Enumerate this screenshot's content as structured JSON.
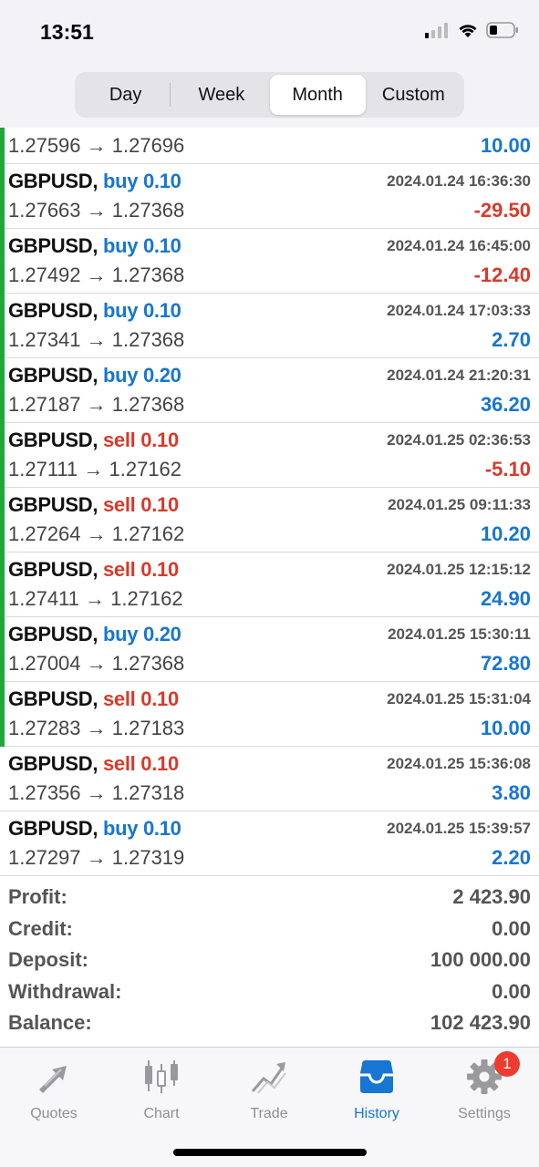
{
  "status": {
    "time": "13:51"
  },
  "period_tabs": [
    {
      "label": "Day",
      "active": false
    },
    {
      "label": "Week",
      "active": false
    },
    {
      "label": "Month",
      "active": true
    },
    {
      "label": "Custom",
      "active": false
    }
  ],
  "first_row": {
    "prices": "1.27596 → 1.27696",
    "profit": "10.00"
  },
  "trades": [
    {
      "symbol": "GBPUSD,",
      "side": "buy",
      "lot": "0.10",
      "time": "2024.01.24 16:36:30",
      "prices": "1.27663 → 1.27368",
      "profit": "-29.50"
    },
    {
      "symbol": "GBPUSD,",
      "side": "buy",
      "lot": "0.10",
      "time": "2024.01.24 16:45:00",
      "prices": "1.27492 → 1.27368",
      "profit": "-12.40"
    },
    {
      "symbol": "GBPUSD,",
      "side": "buy",
      "lot": "0.10",
      "time": "2024.01.24 17:03:33",
      "prices": "1.27341 → 1.27368",
      "profit": "2.70"
    },
    {
      "symbol": "GBPUSD,",
      "side": "buy",
      "lot": "0.20",
      "time": "2024.01.24 21:20:31",
      "prices": "1.27187 → 1.27368",
      "profit": "36.20"
    },
    {
      "symbol": "GBPUSD,",
      "side": "sell",
      "lot": "0.10",
      "time": "2024.01.25 02:36:53",
      "prices": "1.27111 → 1.27162",
      "profit": "-5.10"
    },
    {
      "symbol": "GBPUSD,",
      "side": "sell",
      "lot": "0.10",
      "time": "2024.01.25 09:11:33",
      "prices": "1.27264 → 1.27162",
      "profit": "10.20"
    },
    {
      "symbol": "GBPUSD,",
      "side": "sell",
      "lot": "0.10",
      "time": "2024.01.25 12:15:12",
      "prices": "1.27411 → 1.27162",
      "profit": "24.90"
    },
    {
      "symbol": "GBPUSD,",
      "side": "buy",
      "lot": "0.20",
      "time": "2024.01.25 15:30:11",
      "prices": "1.27004 → 1.27368",
      "profit": "72.80"
    },
    {
      "symbol": "GBPUSD,",
      "side": "sell",
      "lot": "0.10",
      "time": "2024.01.25 15:31:04",
      "prices": "1.27283 → 1.27183",
      "profit": "10.00"
    },
    {
      "symbol": "GBPUSD,",
      "side": "sell",
      "lot": "0.10",
      "time": "2024.01.25 15:36:08",
      "prices": "1.27356 → 1.27318",
      "profit": "3.80"
    },
    {
      "symbol": "GBPUSD,",
      "side": "buy",
      "lot": "0.10",
      "time": "2024.01.25 15:39:57",
      "prices": "1.27297 → 1.27319",
      "profit": "2.20"
    }
  ],
  "green_bar_rows": 10,
  "summary": [
    {
      "label": "Profit:",
      "value": "2 423.90"
    },
    {
      "label": "Credit:",
      "value": "0.00"
    },
    {
      "label": "Deposit:",
      "value": "100 000.00"
    },
    {
      "label": "Withdrawal:",
      "value": "0.00"
    },
    {
      "label": "Balance:",
      "value": "102 423.90"
    }
  ],
  "tabs": {
    "quotes": "Quotes",
    "chart": "Chart",
    "trade": "Trade",
    "history": "History",
    "settings": "Settings",
    "settings_badge": "1"
  },
  "colors": {
    "buy": "#1776d1",
    "sell": "#d83a2a",
    "active_tab": "#1776d1",
    "open_bar": "#1fa83a"
  }
}
